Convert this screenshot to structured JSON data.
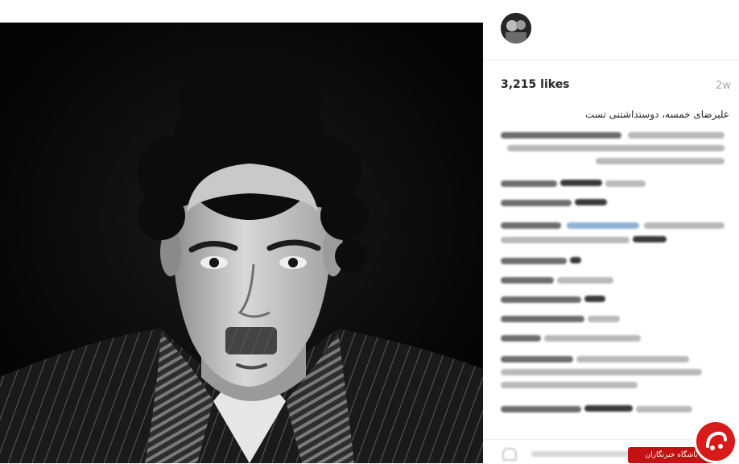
{
  "post": {
    "likes": "3,215 likes",
    "time_ago": "2w",
    "caption": "علیرضای خمسه، دوستداشتنی تست"
  },
  "icons": {
    "avatar": "profile-avatar",
    "heart": "heart-outline-icon",
    "watermark": "news-club-logo"
  },
  "watermark": {
    "label": "باشگاه خبرنگاران",
    "color": "#c41212"
  },
  "colors": {
    "photo_background": "#070707",
    "link": "#3897f0"
  }
}
